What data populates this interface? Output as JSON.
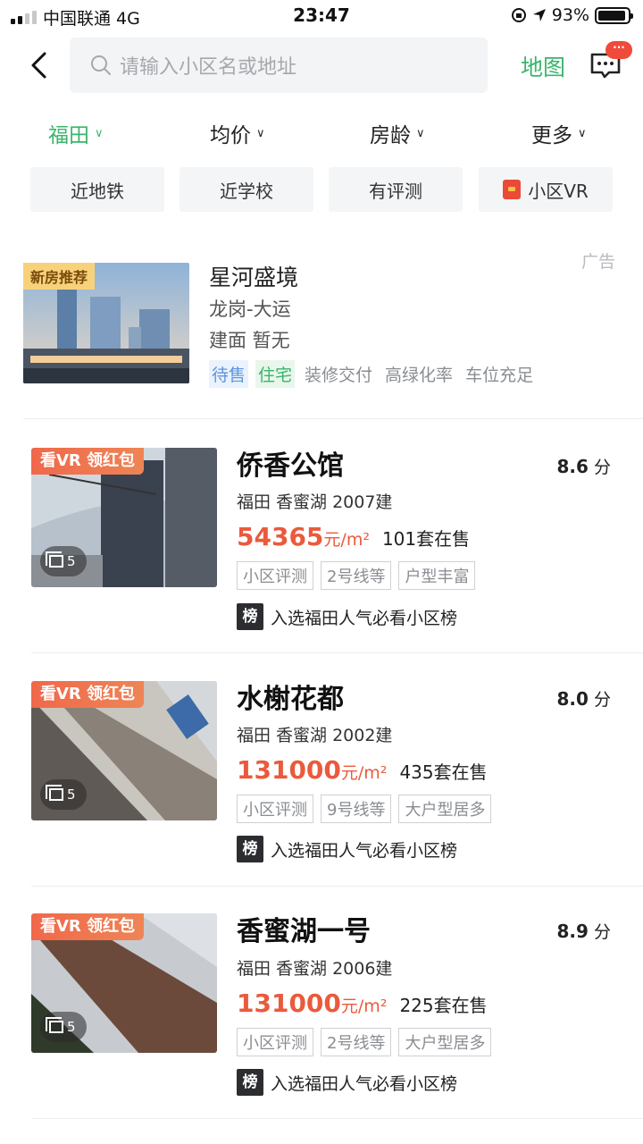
{
  "status": {
    "carrier": "中国联通  4G",
    "time": "23:47",
    "battery": "93%",
    "battery_level": 0.93
  },
  "header": {
    "search_placeholder": "请输入小区名或地址",
    "map_label": "地图",
    "msg_badge": "···"
  },
  "filters": [
    {
      "label": "福田",
      "active": true
    },
    {
      "label": "均价",
      "active": false
    },
    {
      "label": "房龄",
      "active": false
    },
    {
      "label": "更多",
      "active": false
    }
  ],
  "chips": [
    "近地铁",
    "近学校",
    "有评测",
    "小区VR"
  ],
  "ad": {
    "badge": "新房推荐",
    "name": "星河盛境",
    "location": "龙岗-大运",
    "area": "建面 暂无",
    "ad_label": "广告",
    "tags": [
      "待售",
      "住宅",
      "装修交付",
      "高绿化率",
      "车位充足"
    ]
  },
  "listings": [
    {
      "badge": "看VR 领红包",
      "photos": "5",
      "name": "侨香公馆",
      "score": "8.6",
      "score_unit": "分",
      "meta": "福田 香蜜湖 2007建",
      "price": "54365",
      "unit": "元/m²",
      "on_sale": "101套在售",
      "tags": [
        "小区评测",
        "2号线等",
        "户型丰富"
      ],
      "rank_icon": "榜",
      "rank": "入选福田人气必看小区榜"
    },
    {
      "badge": "看VR 领红包",
      "photos": "5",
      "name": "水榭花都",
      "score": "8.0",
      "score_unit": "分",
      "meta": "福田 香蜜湖 2002建",
      "price": "131000",
      "unit": "元/m²",
      "on_sale": "435套在售",
      "tags": [
        "小区评测",
        "9号线等",
        "大户型居多"
      ],
      "rank_icon": "榜",
      "rank": "入选福田人气必看小区榜"
    },
    {
      "badge": "看VR 领红包",
      "photos": "5",
      "name": "香蜜湖一号",
      "score": "8.9",
      "score_unit": "分",
      "meta": "福田 香蜜湖 2006建",
      "price": "131000",
      "unit": "元/m²",
      "on_sale": "225套在售",
      "tags": [
        "小区评测",
        "2号线等",
        "大户型居多"
      ],
      "rank_icon": "榜",
      "rank": "入选福田人气必看小区榜"
    }
  ],
  "colors": {
    "accent": "#3ab56b",
    "price": "#ea5a3c",
    "vr_badge": "#f0684a"
  }
}
